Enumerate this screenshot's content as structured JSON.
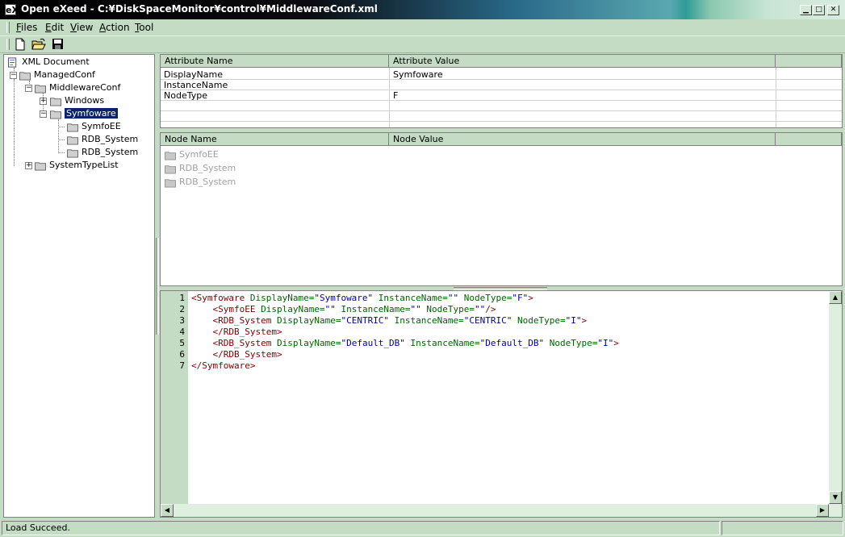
{
  "window": {
    "title": "Open eXeed - C:¥DiskSpaceMonitor¥control¥MiddlewareConf.xml",
    "icon_text": "eX"
  },
  "menu": [
    {
      "hotkey": "F",
      "rest": "iles"
    },
    {
      "hotkey": "E",
      "rest": "dit"
    },
    {
      "hotkey": "V",
      "rest": "iew"
    },
    {
      "hotkey": "A",
      "rest": "ction"
    },
    {
      "hotkey": "T",
      "rest": "ool"
    }
  ],
  "toolbar": {
    "icons": [
      "new-document-icon",
      "open-folder-icon",
      "save-icon"
    ]
  },
  "tree": {
    "root": "XML Document",
    "managed": "ManagedConf",
    "middleware": "MiddlewareConf",
    "windows": "Windows",
    "symfoware": "Symfoware",
    "symfoee": "SymfoEE",
    "rdb1": "RDB_System",
    "rdb2": "RDB_System",
    "systemtype": "SystemTypeList"
  },
  "attributes": {
    "headers": [
      "Attribute Name",
      "Attribute Value"
    ],
    "rows": [
      {
        "name": "DisplayName",
        "value": "Symfoware"
      },
      {
        "name": "InstanceName",
        "value": ""
      },
      {
        "name": "NodeType",
        "value": "F"
      }
    ]
  },
  "nodes": {
    "headers": [
      "Node Name",
      "Node Value"
    ],
    "rows": [
      "SymfoEE",
      "RDB_System",
      "RDB_System"
    ]
  },
  "editor": {
    "lines": [
      {
        "n": "1",
        "indent": "",
        "parts": [
          [
            "tag",
            "<Symfoware"
          ],
          [
            "attr",
            " DisplayName="
          ],
          [
            "val",
            "\"Symfoware\""
          ],
          [
            "attr",
            " InstanceName="
          ],
          [
            "val",
            "\"\""
          ],
          [
            "attr",
            " NodeType="
          ],
          [
            "val",
            "\"F\""
          ],
          [
            "tag",
            ">"
          ]
        ]
      },
      {
        "n": "2",
        "indent": "    ",
        "parts": [
          [
            "tag",
            "<SymfoEE"
          ],
          [
            "attr",
            " DisplayName="
          ],
          [
            "val",
            "\"\""
          ],
          [
            "attr",
            " InstanceName="
          ],
          [
            "val",
            "\"\""
          ],
          [
            "attr",
            " NodeType="
          ],
          [
            "val",
            "\"\""
          ],
          [
            "tag",
            "/>"
          ]
        ]
      },
      {
        "n": "3",
        "indent": "    ",
        "parts": [
          [
            "tag",
            "<RDB_System"
          ],
          [
            "attr",
            " DisplayName="
          ],
          [
            "val",
            "\"CENTRIC\""
          ],
          [
            "attr",
            " InstanceName="
          ],
          [
            "val",
            "\"CENTRIC\""
          ],
          [
            "attr",
            " NodeType="
          ],
          [
            "val",
            "\"I\""
          ],
          [
            "tag",
            ">"
          ]
        ]
      },
      {
        "n": "4",
        "indent": "    ",
        "parts": [
          [
            "tag",
            "</RDB_System>"
          ]
        ]
      },
      {
        "n": "5",
        "indent": "    ",
        "parts": [
          [
            "tag",
            "<RDB_System"
          ],
          [
            "attr",
            " DisplayName="
          ],
          [
            "val",
            "\"Default_DB\""
          ],
          [
            "attr",
            " InstanceName="
          ],
          [
            "val",
            "\"Default_DB\""
          ],
          [
            "attr",
            " NodeType="
          ],
          [
            "val",
            "\"I\""
          ],
          [
            "tag",
            ">"
          ]
        ]
      },
      {
        "n": "6",
        "indent": "    ",
        "parts": [
          [
            "tag",
            "</RDB_System>"
          ]
        ]
      },
      {
        "n": "7",
        "indent": "",
        "parts": [
          [
            "tag",
            "</Symfoware>"
          ]
        ]
      }
    ]
  },
  "status": {
    "message": "Load Succeed."
  }
}
